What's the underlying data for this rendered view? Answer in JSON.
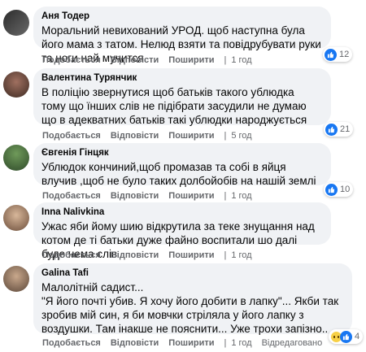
{
  "comments": [
    {
      "author": "Аня Тодер",
      "text": "Моральний невихований УРОД. щоб наступна була його мама з татом. Нелюд взяти та повідрубувати руки та ноги най мучится.",
      "like_label": "Подобається",
      "reply_label": "Відповісти",
      "share_label": "Поширити",
      "time": "1 год",
      "reaction_count": "12",
      "reactions": [
        "like-icon"
      ]
    },
    {
      "author": "Валентина Турянчик",
      "text": "В поліцію звернутися щоб батьків такого ублюдка тому що їнших слів не підібрати засудили не думаю що в адекватних батьків такі ублюдки народжується",
      "like_label": "Подобається",
      "reply_label": "Відповісти",
      "share_label": "Поширити",
      "time": "5 год",
      "reaction_count": "21",
      "reactions": [
        "like-icon"
      ]
    },
    {
      "author": "Євгенія Гінцяк",
      "text": "Ублюдок кончиний,щоб промазав та собі в яйця влучив ,щоб не було таких долбойобів на нашій землі",
      "like_label": "Подобається",
      "reply_label": "Відповісти",
      "share_label": "Поширити",
      "time": "1 год",
      "reaction_count": "10",
      "reactions": [
        "like-icon"
      ]
    },
    {
      "author": "Inna Nalivkina",
      "text": "Ужас яби йому шию відкрутила за теке знущання над котом де ті батьки дуже файно воспитали шо далі буде нема слів",
      "like_label": "Подобається",
      "reply_label": "Відповісти",
      "share_label": "Поширити",
      "time": "1 год"
    },
    {
      "author": "Galina Tafi",
      "text": "Малолітній садист...\n\"Я його почті убив. Я хочу його добити в лапку\"... Якби так зробив мій син, я би мовчки стріляла у його лапку з воздушки. Там інакше не пояснити... Уже трохи запізно..",
      "like_label": "Подобається",
      "reply_label": "Відповісти",
      "share_label": "Поширити",
      "time": "1 год",
      "edited": "Відредаговано",
      "reaction_count": "4",
      "reactions": [
        "sad-icon",
        "like-icon"
      ]
    }
  ],
  "colors": {
    "bubble": "#f0f2f5",
    "action_text": "#65676b",
    "like_blue": "#1877f2"
  }
}
